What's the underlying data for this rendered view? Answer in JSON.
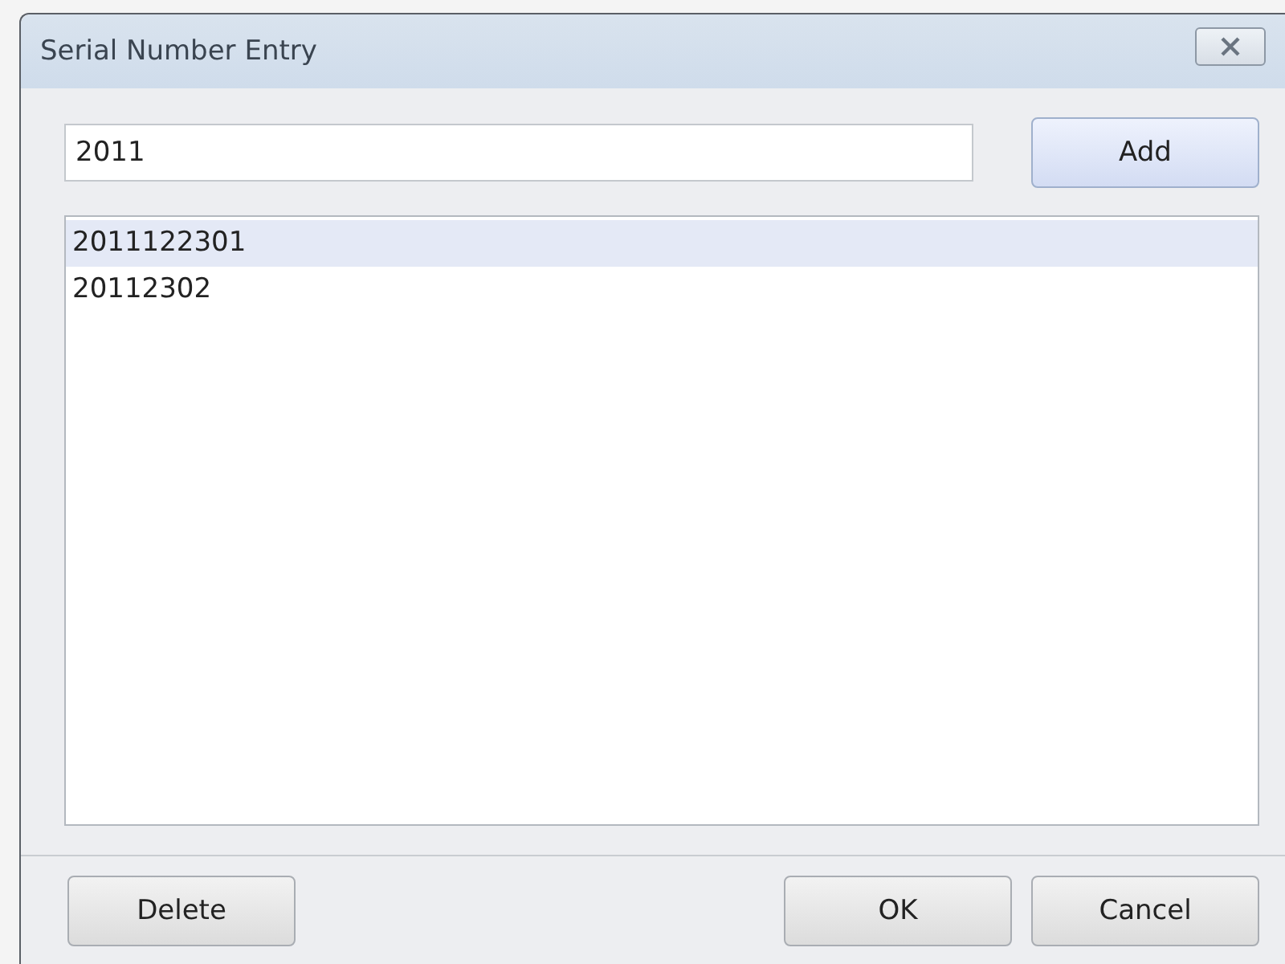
{
  "window": {
    "title": "Serial Number Entry"
  },
  "entry": {
    "value": "2011"
  },
  "add_button": {
    "label": "Add",
    "focused": true
  },
  "serials": [
    {
      "text": "2011122301",
      "selected": true
    },
    {
      "text": "20112302",
      "selected": false
    }
  ],
  "buttons": [
    {
      "label": "Delete",
      "focused": false
    },
    {
      "label": "OK",
      "focused": false
    },
    {
      "label": "Cancel",
      "focused": false
    }
  ]
}
